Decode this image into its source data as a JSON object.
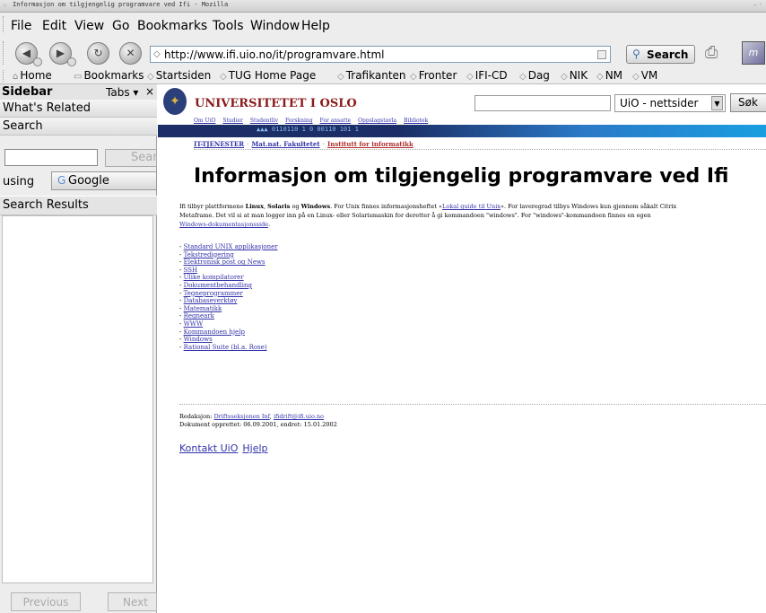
{
  "window": {
    "title": "Informasjon om tilgjengelig programvare ved Ifi - Mozilla"
  },
  "menu": [
    "File",
    "Edit",
    "View",
    "Go",
    "Bookmarks",
    "Tools",
    "Window",
    "Help"
  ],
  "nav": {
    "url": "http://www.ifi.uio.no/it/programvare.html",
    "search_label": "Search"
  },
  "bookmarks": {
    "home": "Home",
    "bookmarks": "Bookmarks",
    "items": [
      "Startsiden",
      "TUG Home Page",
      "Trafikanten",
      "Fronter",
      "IFI-CD",
      "Dag",
      "NIK",
      "NM",
      "VM"
    ]
  },
  "sidebar": {
    "title": "Sidebar",
    "tabs": "Tabs",
    "close": "×",
    "whats_related": "What's Related",
    "search": "Search",
    "search_button": "Search",
    "using": "using",
    "engine": "Google",
    "results": "Search Results",
    "previous": "Previous",
    "next": "Next"
  },
  "uio": {
    "name": "UNIVERSITETET I OSLO",
    "search_scope": "UiO - nettsider",
    "search_button": "Søk",
    "links": [
      "Om UiO",
      "Studier",
      "Studentliv",
      "Forskning",
      "For ansatte",
      "Oppslagstavla",
      "Bibliotek"
    ],
    "breadcrumb": [
      "IT-TJENESTER",
      "Mat.nat. Fakultetet",
      "Institutt for informatikk"
    ]
  },
  "page": {
    "heading": "Informasjon om tilgjengelig programvare ved Ifi",
    "intro": {
      "t1": "Ifi tilbyr plattformene ",
      "linux": "Linux",
      "t2": ", ",
      "solaris": "Solaris",
      "t3": " og ",
      "windows": "Windows",
      "t4": ". For Unix finnes informasjonsheftet «",
      "link1": "Lokal guide til Unix",
      "t5": "». For laveregrad tilbys Windows kun gjennom såkalt Citrix",
      "line2": "Metaframe. Det vil si at man logger inn på en Linux- eller Solarismaskin for deretter å gi kommandoen \"windows\". For \"windows\"-kommandoen finnes en egen",
      "link2": "Windows-dokumentasjonsside",
      "t6": "."
    },
    "toc": [
      "Standard UNIX applikasjoner",
      "Tekstredigering",
      "Elektronisk post og News",
      "SSH",
      "Ulike kompilatorer",
      "Dokumentbehandling",
      "Tegneprogrammer",
      "Databaseverktøy",
      "Matematikk",
      "Regneark",
      "WWW",
      "Kommandoen hjelp",
      "Windows",
      "Rational Suite (bl.a. Rose)"
    ],
    "footer": {
      "redaksjon": "Redaksjon: ",
      "link1": "Driftsseksjonen Inf",
      "comma": ", ",
      "link2": "ifidrift@ifi.uio.no",
      "dates": "Dokument opprettet: 06.09.2001, endret: 15.01.2002"
    },
    "contact": [
      "Kontakt UiO",
      "Hjelp"
    ]
  }
}
